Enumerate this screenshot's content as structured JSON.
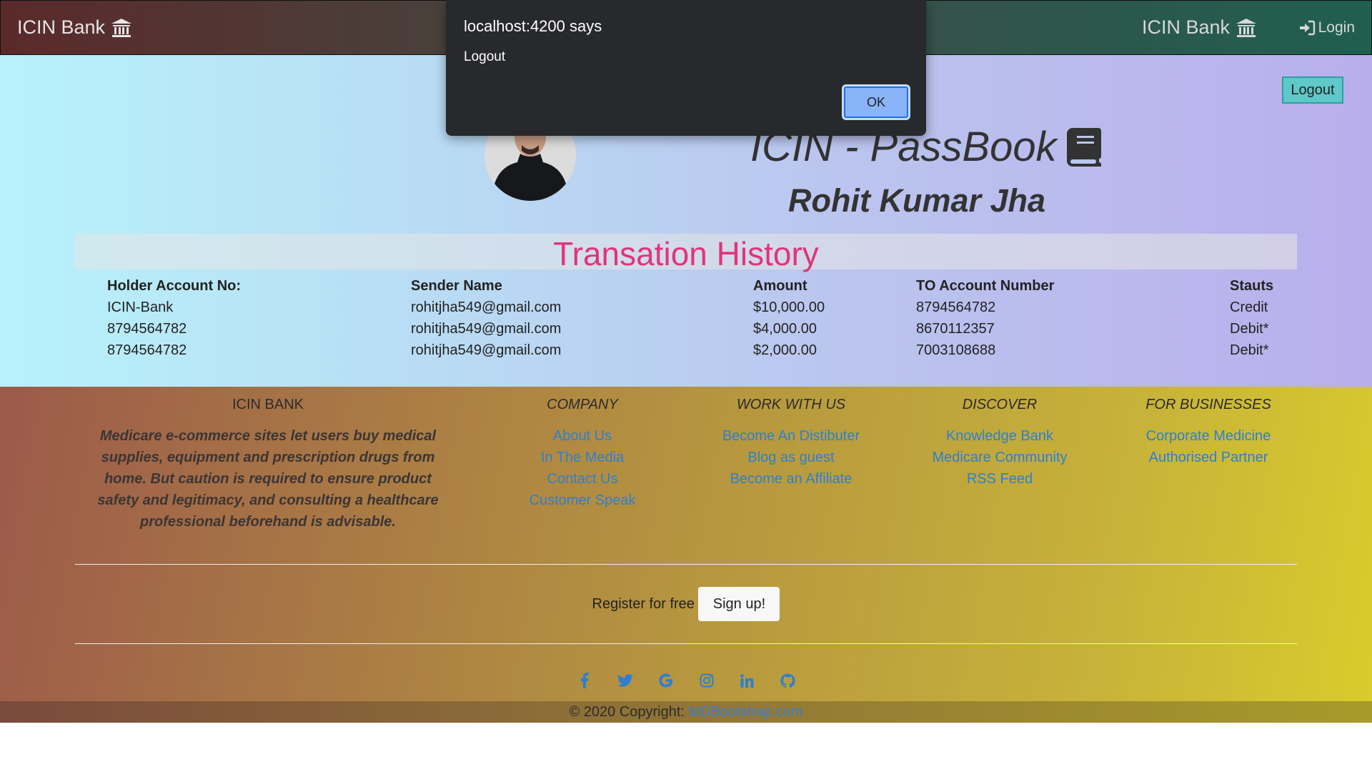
{
  "navbar": {
    "brand_left": "ICIN Bank",
    "brand_right": "ICIN Bank",
    "login": "Login"
  },
  "passbook": {
    "logout_label": "Logout",
    "title": "ICIN - PassBook",
    "holder_name": "Rohit Kumar Jha",
    "history_title": "Transation History",
    "headers": [
      "Holder Account No:",
      "Sender Name",
      "Amount",
      "TO Account Number",
      "Stauts"
    ],
    "rows": [
      [
        "ICIN-Bank",
        "rohitjha549@gmail.com",
        "$10,000.00",
        "8794564782",
        "Credit"
      ],
      [
        "8794564782",
        "rohitjha549@gmail.com",
        "$4,000.00",
        "8670112357",
        "Debit*"
      ],
      [
        "8794564782",
        "rohitjha549@gmail.com",
        "$2,000.00",
        "7003108688",
        "Debit*"
      ]
    ]
  },
  "footer": {
    "brand_title": "ICIN BANK",
    "about_text": "Medicare e-commerce sites let users buy medical supplies, equipment and prescription drugs from home. But caution is required to ensure product safety and legitimacy, and consulting a healthcare professional beforehand is advisable.",
    "columns": [
      {
        "title": "COMPANY",
        "links": [
          "About Us",
          "In The Media",
          "Contact Us",
          "Customer Speak"
        ]
      },
      {
        "title": "WORK WITH US",
        "links": [
          "Become An Distibuter",
          "Blog as guest",
          "Become an Affiliate"
        ]
      },
      {
        "title": "DISCOVER",
        "links": [
          "Knowledge Bank",
          "Medicare Community",
          "RSS Feed"
        ]
      },
      {
        "title": "FOR BUSINESSES",
        "links": [
          "Corporate Medicine",
          "Authorised Partner"
        ]
      }
    ],
    "register_text": "Register for free",
    "signup_label": "Sign up!",
    "social_icons": [
      "facebook-icon",
      "twitter-icon",
      "google-icon",
      "instagram-icon",
      "linkedin-icon",
      "github-icon"
    ],
    "copyright_text": "© 2020 Copyright:",
    "copyright_link": "MDBootstrap.com"
  },
  "dialog": {
    "title": "localhost:4200 says",
    "message": "Logout",
    "ok_label": "OK"
  },
  "colors": {
    "history_title": "#e0357a",
    "link": "#2e7fd0",
    "logout_btn": "#5fc8c8",
    "dialog_bg": "#28292c",
    "dialog_ok": "#8ab4f8"
  }
}
